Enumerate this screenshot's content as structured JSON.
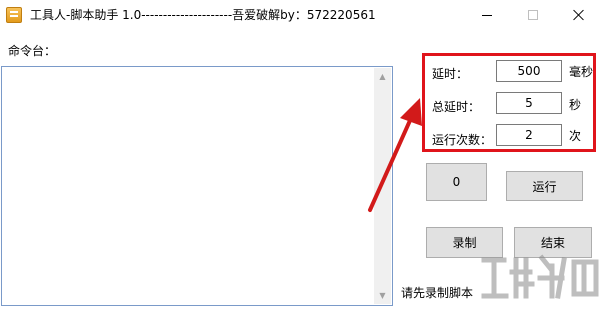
{
  "window": {
    "title": "工具人-脚本助手 1.0---------------------吾爱破解by：572220561"
  },
  "console": {
    "label": "命令台：",
    "content": ""
  },
  "settings": {
    "delay": {
      "label": "延时：",
      "value": "500",
      "unit": "毫秒"
    },
    "total_delay": {
      "label": "总延时：",
      "value": "5",
      "unit": "秒"
    },
    "run_count": {
      "label": "运行次数：",
      "value": "2",
      "unit": "次"
    },
    "highlight_color": "#e0141b"
  },
  "buttons": {
    "counter_label": "0",
    "run_label": "运行",
    "record_label": "录制",
    "end_label": "结束"
  },
  "status": {
    "text": "请先录制脚本"
  },
  "annotation": {
    "arrow_color": "#d21a1a"
  },
  "icons": {
    "app": "app-icon",
    "minimize": "minimize-icon",
    "maximize": "maximize-icon",
    "close": "close-icon"
  }
}
